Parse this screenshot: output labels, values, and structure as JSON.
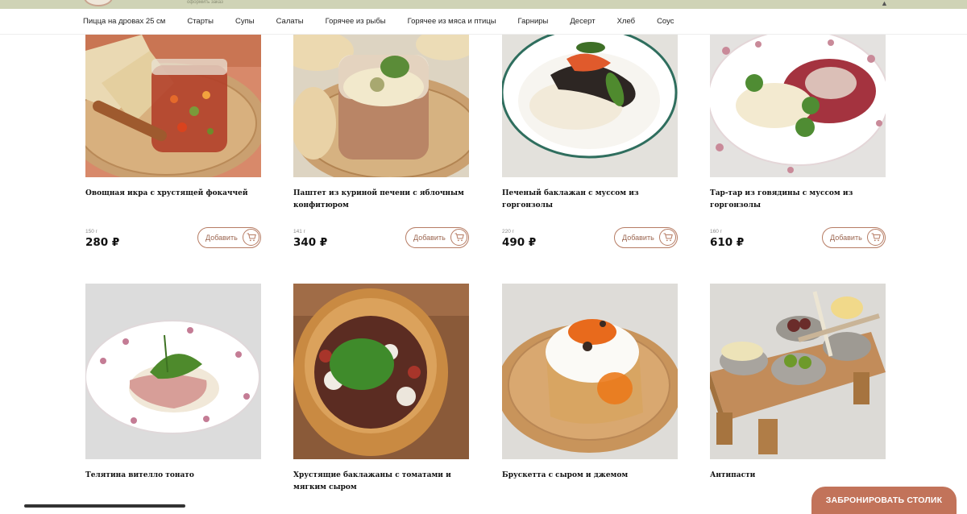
{
  "header": {
    "subtitle": "оформить заказ",
    "corner_glyph": "▲"
  },
  "nav": {
    "items": [
      "Пицца на дровах 25 см",
      "Старты",
      "Супы",
      "Салаты",
      "Горячее из рыбы",
      "Горячее из мяса и птицы",
      "Гарниры",
      "Десерт",
      "Хлеб",
      "Соус"
    ]
  },
  "products": [
    {
      "name": "Овощная икра с хрустящей фокаччей",
      "weight": "150 г",
      "price": "280 ₽",
      "add_label": "Добавить"
    },
    {
      "name": "Паштет из куриной печени с яблочным конфитюром",
      "weight": "141 г",
      "price": "340 ₽",
      "add_label": "Добавить"
    },
    {
      "name": "Печеный баклажан с муссом из горгонзолы",
      "weight": "220 г",
      "price": "490 ₽",
      "add_label": "Добавить"
    },
    {
      "name": "Тар-тар из говядины с муссом из горгонзолы",
      "weight": "160 г",
      "price": "610 ₽",
      "add_label": "Добавить"
    },
    {
      "name": "Телятина вителло тонато",
      "weight": "",
      "price": "",
      "add_label": ""
    },
    {
      "name": "Хрустящие баклажаны с томатами и мягким сыром",
      "weight": "",
      "price": "",
      "add_label": ""
    },
    {
      "name": "Брускетта с сыром и джемом",
      "weight": "",
      "price": "",
      "add_label": ""
    },
    {
      "name": "Антипасти",
      "weight": "",
      "price": "",
      "add_label": ""
    }
  ],
  "reserve_button": {
    "label": "ЗАБРОНИРОВАТЬ СТОЛИК"
  },
  "colors": {
    "accent": "#b67c64",
    "topbar": "#cfd3b6",
    "reserve_bg": "#c2735a"
  }
}
